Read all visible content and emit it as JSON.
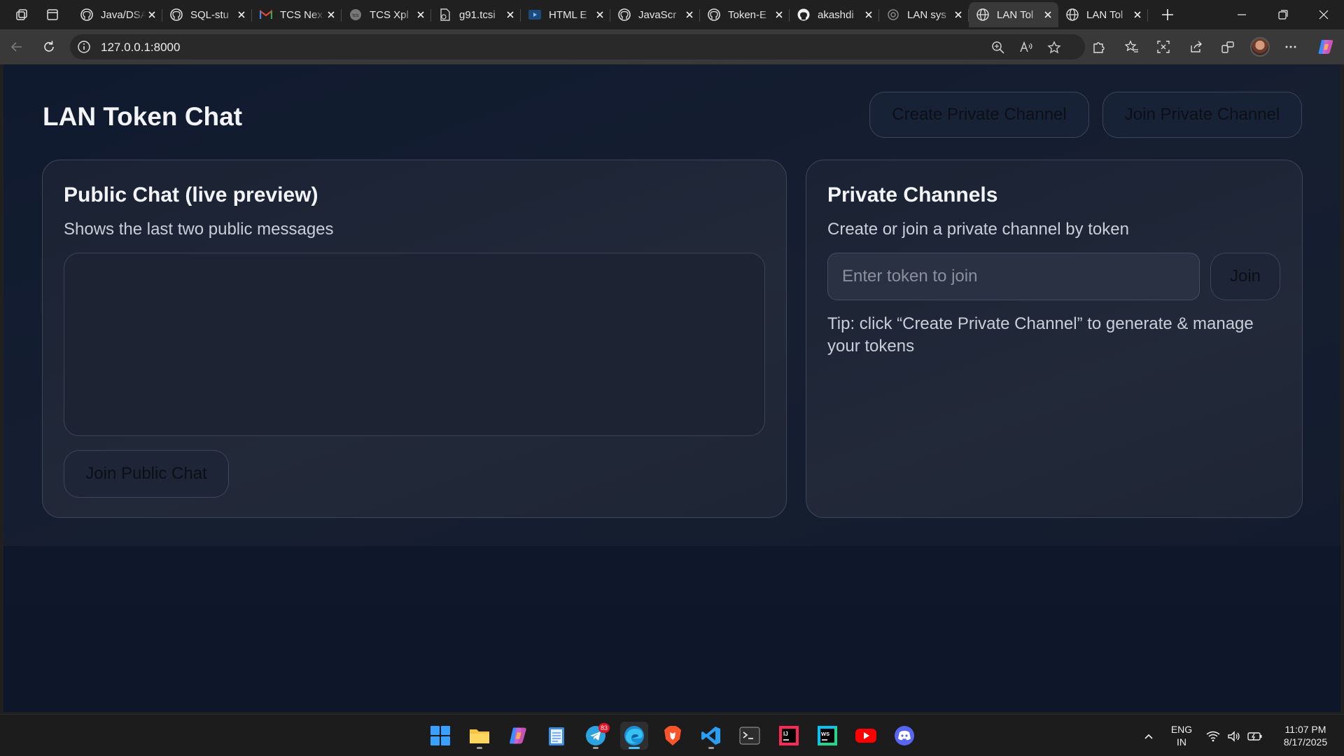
{
  "browser": {
    "tabs": [
      {
        "title": "Java/DSA",
        "icon": "github-icon",
        "active": false
      },
      {
        "title": "SQL-stu",
        "icon": "github-icon",
        "active": false
      },
      {
        "title": "TCS Nex",
        "icon": "gmail-icon",
        "active": false
      },
      {
        "title": "TCS Xpl",
        "icon": "tcs-icon",
        "active": false
      },
      {
        "title": "g91.tcsi",
        "icon": "page-icon",
        "active": false
      },
      {
        "title": "HTML E",
        "icon": "video-icon",
        "active": false
      },
      {
        "title": "JavaScr",
        "icon": "github-icon",
        "active": false
      },
      {
        "title": "Token-E",
        "icon": "github-icon",
        "active": false
      },
      {
        "title": "akashdi",
        "icon": "github-icon",
        "active": false
      },
      {
        "title": "LAN sys",
        "icon": "openai-icon",
        "active": false
      },
      {
        "title": "LAN Tol",
        "icon": "globe-icon",
        "active": true
      },
      {
        "title": "LAN Tol",
        "icon": "globe-icon",
        "active": false
      }
    ],
    "address": "127.0.0.1:8000"
  },
  "app": {
    "title": "LAN Token Chat",
    "create_channel_label": "Create Private Channel",
    "join_channel_label": "Join Private Channel"
  },
  "public_chat": {
    "title": "Public Chat (live preview)",
    "subtitle": "Shows the last two public messages",
    "join_label": "Join Public Chat"
  },
  "private_channels": {
    "title": "Private Channels",
    "subtitle": "Create or join a private channel by token",
    "token_placeholder": "Enter token to join",
    "join_label": "Join",
    "tip": "Tip: click “Create Private Channel” to generate & manage your tokens"
  },
  "taskbar": {
    "apps": [
      "start-icon",
      "file-explorer-icon",
      "copilot-icon",
      "notepad-icon",
      "telegram-icon",
      "edge-icon",
      "brave-icon",
      "vscode-icon",
      "terminal-icon",
      "intellij-icon",
      "webstorm-icon",
      "youtube-icon",
      "discord-icon"
    ],
    "telegram_badge": "83",
    "language": "ENG",
    "region": "IN",
    "time": "11:07 PM",
    "date": "8/17/2025"
  },
  "colors": {
    "page_bg": "#111a2e",
    "card_border": "#3d4659",
    "edge_accent": "#4cc2ff"
  }
}
